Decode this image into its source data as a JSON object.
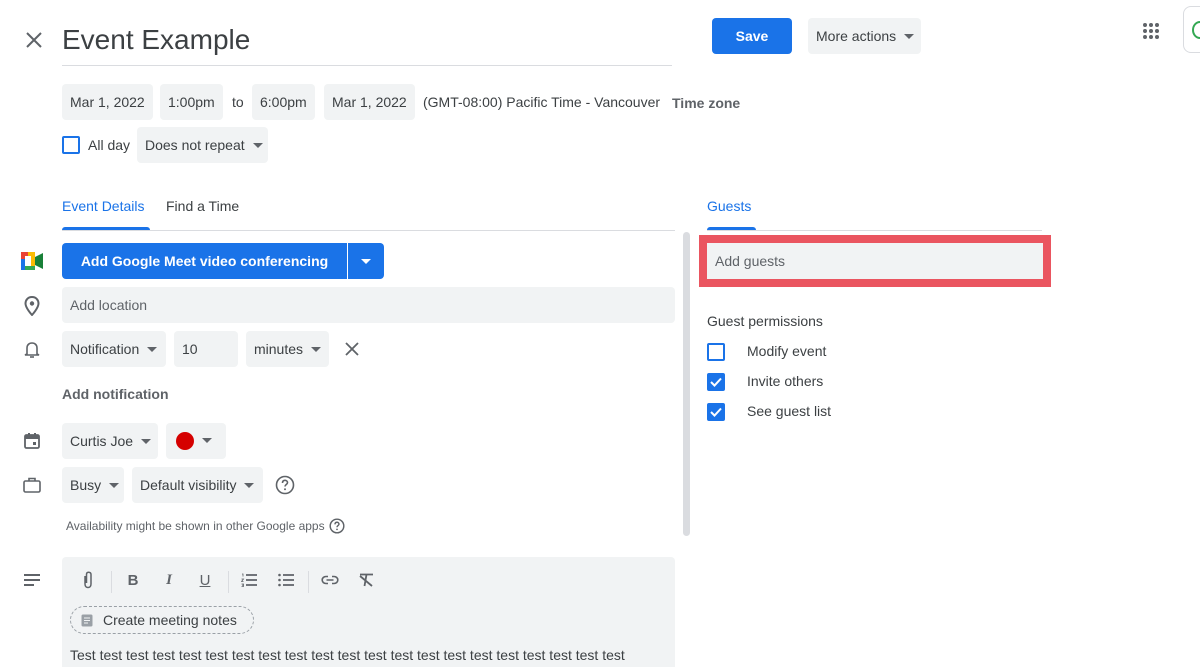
{
  "header": {
    "title": "Event Example",
    "save_label": "Save",
    "more_actions_label": "More actions"
  },
  "datetime": {
    "start_date": "Mar 1, 2022",
    "start_time": "1:00pm",
    "to_label": "to",
    "end_time": "6:00pm",
    "end_date": "Mar 1, 2022",
    "timezone_text": "(GMT-08:00) Pacific Time - Vancouver",
    "timezone_link": "Time zone",
    "all_day_label": "All day",
    "all_day_checked": false,
    "repeat_value": "Does not repeat"
  },
  "tabs": {
    "event_details": "Event Details",
    "find_a_time": "Find a Time",
    "active": "Event Details"
  },
  "details": {
    "meet_button_label": "Add Google Meet video conferencing",
    "location_placeholder": "Add location",
    "notification_type": "Notification",
    "notification_value": "10",
    "notification_unit": "minutes",
    "add_notification_label": "Add notification",
    "calendar_owner": "Curtis Joe",
    "event_color": "#d50000",
    "busy_status": "Busy",
    "visibility": "Default visibility",
    "availability_note": "Availability might be shown in other Google apps",
    "toolbar": [
      "attach-icon",
      "bold-icon",
      "italic-icon",
      "underline-icon",
      "numbered-list-icon",
      "bulleted-list-icon",
      "link-icon",
      "clear-formatting-icon"
    ],
    "create_notes_label": "Create meeting notes",
    "description_text": "Test test test test test test test test test test test test test test test test test test test test test"
  },
  "guests": {
    "tab_label": "Guests",
    "add_guests_placeholder": "Add guests",
    "permissions_label": "Guest permissions",
    "permissions": [
      {
        "label": "Modify event",
        "checked": false
      },
      {
        "label": "Invite others",
        "checked": true
      },
      {
        "label": "See guest list",
        "checked": true
      }
    ]
  },
  "colors": {
    "accent": "#1a73e8",
    "highlight": "#ea5560",
    "chip_bg": "#f1f3f4"
  }
}
